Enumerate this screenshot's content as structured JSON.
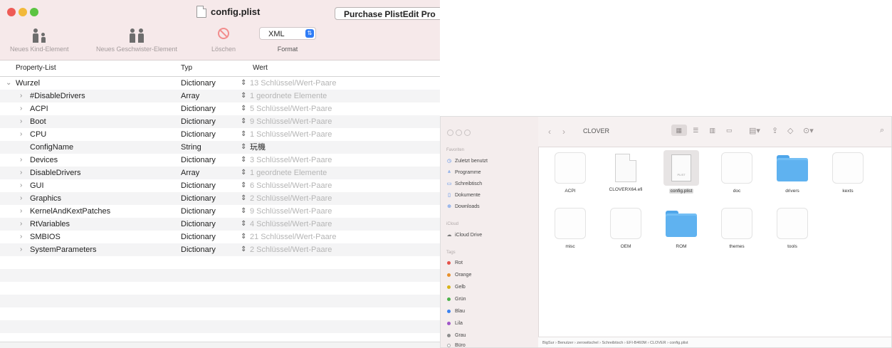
{
  "plistedit": {
    "title": "config.plist",
    "purchase_label": "Purchase PlistEdit Pro",
    "toolbar": {
      "new_child": "Neues Kind-Element",
      "new_sibling": "Neues Geschwister-Element",
      "delete": "Löschen",
      "format_value": "XML",
      "format_label": "Format"
    },
    "columns": {
      "key": "Property-List",
      "type": "Typ",
      "value": "Wert"
    },
    "rows": [
      {
        "key": "Wurzel",
        "type": "Dictionary",
        "value": "13 Schlüssel/Wert-Paare"
      },
      {
        "key": "#DisableDrivers",
        "type": "Array",
        "value": "1 geordnete Elemente"
      },
      {
        "key": "ACPI",
        "type": "Dictionary",
        "value": "5 Schlüssel/Wert-Paare"
      },
      {
        "key": "Boot",
        "type": "Dictionary",
        "value": "9 Schlüssel/Wert-Paare"
      },
      {
        "key": "CPU",
        "type": "Dictionary",
        "value": "1 Schlüssel/Wert-Paare"
      },
      {
        "key": "ConfigName",
        "type": "String",
        "value": "玩機"
      },
      {
        "key": "Devices",
        "type": "Dictionary",
        "value": "3 Schlüssel/Wert-Paare"
      },
      {
        "key": "DisableDrivers",
        "type": "Array",
        "value": "1 geordnete Elemente"
      },
      {
        "key": "GUI",
        "type": "Dictionary",
        "value": "6 Schlüssel/Wert-Paare"
      },
      {
        "key": "Graphics",
        "type": "Dictionary",
        "value": "2 Schlüssel/Wert-Paare"
      },
      {
        "key": "KernelAndKextPatches",
        "type": "Dictionary",
        "value": "9 Schlüssel/Wert-Paare"
      },
      {
        "key": "RtVariables",
        "type": "Dictionary",
        "value": "4 Schlüssel/Wert-Paare"
      },
      {
        "key": "SMBIOS",
        "type": "Dictionary",
        "value": "21 Schlüssel/Wert-Paare"
      },
      {
        "key": "SystemParameters",
        "type": "Dictionary",
        "value": "2 Schlüssel/Wert-Paare"
      }
    ]
  },
  "finder": {
    "title": "CLOVER",
    "sidebar": {
      "favorites_header": "Favoriten",
      "favorites": [
        "Zuletzt benutzt",
        "Programme",
        "Schreibtisch",
        "Dokumente",
        "Downloads"
      ],
      "icloud_header": "iCloud",
      "icloud": [
        "iCloud Drive"
      ],
      "tags_header": "Tags",
      "tags": [
        {
          "name": "Rot",
          "color": "#e5534b"
        },
        {
          "name": "Orange",
          "color": "#e8912d"
        },
        {
          "name": "Gelb",
          "color": "#d8b418"
        },
        {
          "name": "Grün",
          "color": "#4cb24a"
        },
        {
          "name": "Blau",
          "color": "#3a82f0"
        },
        {
          "name": "Lila",
          "color": "#a056c8"
        },
        {
          "name": "Grau",
          "color": "#8e8e8e"
        },
        {
          "name": "Büro",
          "color": "#ffffff"
        }
      ]
    },
    "items": [
      "ACPI",
      "CLOVERX64.efi",
      "config.plist",
      "doc",
      "drivers",
      "kexts",
      "misc",
      "OEM",
      "ROM",
      "themes",
      "tools"
    ],
    "pathbar": "BigSur › Benutzer › zerowitschel › Schreibtisch › EFI-B460M › CLOVER › config.plist"
  }
}
